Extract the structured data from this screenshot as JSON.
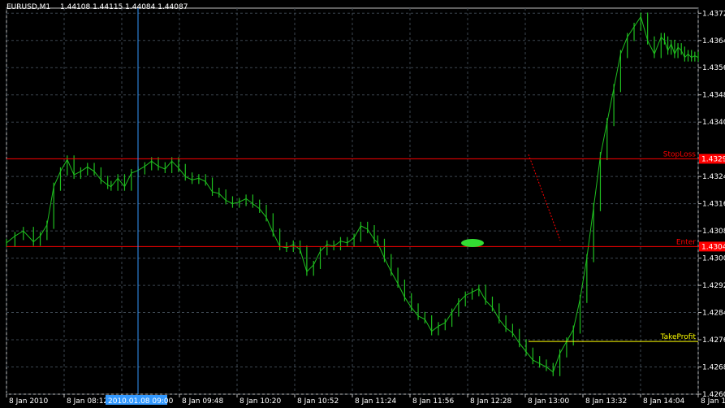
{
  "header": {
    "symbol": "EURUSD,M1",
    "ohlc": "1.44108 1.44115 1.44084 1.44087"
  },
  "colors": {
    "background": "#000000",
    "grid": "#3c4650",
    "candles": "#1fbf1f",
    "stoploss_line": "#ff0000",
    "enter_line": "#ff0000",
    "takeprofit_line": "#ffff00",
    "crosshair": "#3399ff",
    "entry_marker": "#33dd33"
  },
  "crosshair_time_label": "2010.01.08 09:00",
  "chart_data": {
    "type": "line",
    "title": "",
    "xlabel": "",
    "ylabel": "",
    "ylim": [
      1.426,
      1.43735
    ],
    "y_ticks": [
      "1.4372",
      "1.4364",
      "1.4356",
      "1.4348",
      "1.4340",
      "1.4324",
      "1.4316",
      "1.4308",
      "1.4300",
      "1.4292",
      "1.4284",
      "1.4276",
      "1.4268",
      "1.4260"
    ],
    "y_tick_values": [
      1.4372,
      1.4364,
      1.4356,
      1.4348,
      1.434,
      1.4324,
      1.4316,
      1.4308,
      1.43,
      1.4292,
      1.4284,
      1.4276,
      1.4268,
      1.426
    ],
    "x_ticks": [
      "8 Jan 2010",
      "8 Jan 08:12",
      "8 Jan 09:16",
      "8 Jan 09:48",
      "8 Jan 10:20",
      "8 Jan 10:52",
      "8 Jan 11:24",
      "8 Jan 11:56",
      "8 Jan 12:28",
      "8 Jan 13:00",
      "8 Jan 13:32",
      "8 Jan 14:04",
      "8 Jan 14:36"
    ],
    "grid": true,
    "series": [
      {
        "name": "",
        "x_minutes": [
          0,
          5,
          10,
          16,
          20,
          24,
          28,
          32,
          36,
          40,
          44,
          48,
          52,
          56,
          60,
          62,
          66,
          70,
          74,
          78,
          82,
          86,
          90,
          94,
          98,
          102,
          106,
          110,
          114,
          118,
          122,
          126,
          130,
          134,
          138,
          142,
          146,
          150,
          154,
          158,
          162,
          166,
          170,
          174,
          178,
          182,
          186,
          190,
          194,
          198,
          202,
          206,
          210,
          214,
          218,
          220,
          224,
          228,
          232,
          236,
          240,
          244,
          248,
          252,
          256,
          260,
          264,
          268,
          272,
          276,
          280,
          284,
          288,
          292,
          296,
          300,
          304,
          308,
          312,
          316,
          320,
          324,
          328,
          332,
          336,
          340,
          344,
          348,
          352,
          356,
          360,
          364,
          368,
          372,
          376,
          380,
          384,
          388,
          390,
          392,
          394,
          396,
          398,
          400,
          402,
          404,
          406,
          408,
          410
        ],
        "values": [
          1.43045,
          1.43065,
          1.4308,
          1.43048,
          1.43065,
          1.43098,
          1.4321,
          1.43255,
          1.4329,
          1.43245,
          1.43255,
          1.43268,
          1.43255,
          1.4323,
          1.43215,
          1.4321,
          1.43235,
          1.4321,
          1.4325,
          1.43258,
          1.4327,
          1.43285,
          1.4327,
          1.43262,
          1.43285,
          1.43265,
          1.4324,
          1.4323,
          1.43235,
          1.43225,
          1.43195,
          1.4319,
          1.4317,
          1.4316,
          1.43165,
          1.43175,
          1.4316,
          1.43145,
          1.4312,
          1.43075,
          1.43035,
          1.4303,
          1.4304,
          1.43025,
          1.4296,
          1.4298,
          1.4302,
          1.4304,
          1.43035,
          1.4305,
          1.43045,
          1.4306,
          1.43095,
          1.43085,
          1.43055,
          1.43045,
          1.43,
          1.4296,
          1.42925,
          1.42885,
          1.42855,
          1.4283,
          1.4282,
          1.42785,
          1.428,
          1.4281,
          1.4284,
          1.4287,
          1.4289,
          1.429,
          1.4291,
          1.42875,
          1.42855,
          1.4282,
          1.42795,
          1.4278,
          1.4275,
          1.42725,
          1.427,
          1.4269,
          1.4268,
          1.42665,
          1.4272,
          1.42755,
          1.4279,
          1.4288,
          1.43,
          1.4315,
          1.433,
          1.434,
          1.435,
          1.436,
          1.4365,
          1.4368,
          1.4371,
          1.4364,
          1.436,
          1.4365,
          1.4364,
          1.4361,
          1.4363,
          1.436,
          1.4362,
          1.4361,
          1.4359,
          1.436,
          1.4359,
          1.43595,
          1.4359
        ]
      }
    ],
    "levels": [
      {
        "name": "StopLoss",
        "value": 1.43292,
        "price_label": "1.4329"
      },
      {
        "name": "Enter",
        "value": 1.43034,
        "price_label": "1.4304"
      },
      {
        "name": "TakeProfit",
        "value": 1.42755,
        "price_label": ""
      }
    ]
  }
}
